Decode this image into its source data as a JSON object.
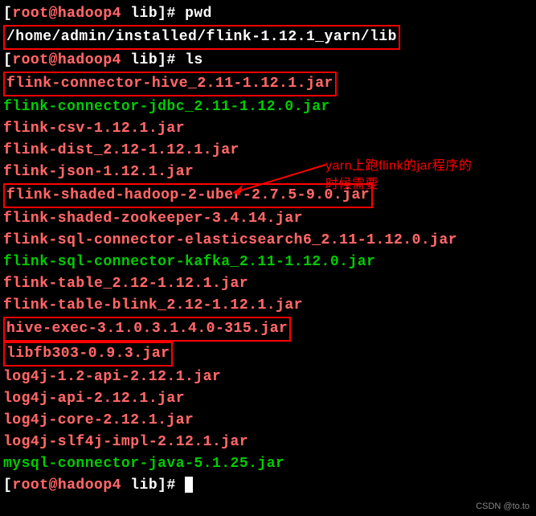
{
  "prompt1": {
    "bracket_open": "[",
    "user_host": "root@hadoop4",
    "path": " lib",
    "bracket_close": "]# ",
    "cmd": "pwd"
  },
  "pwd_output": "/home/admin/installed/flink-1.12.1_yarn/lib",
  "prompt2": {
    "bracket_open": "[",
    "user_host": "root@hadoop4",
    "path": " lib",
    "bracket_close": "]# ",
    "cmd": "ls"
  },
  "files": [
    {
      "name": "flink-connector-hive_2.11-1.12.1.jar",
      "color": "brightred",
      "boxed": true
    },
    {
      "name": "flink-connector-jdbc_2.11-1.12.0.jar",
      "color": "green",
      "boxed": false
    },
    {
      "name": "flink-csv-1.12.1.jar",
      "color": "brightred",
      "boxed": false
    },
    {
      "name": "flink-dist_2.12-1.12.1.jar",
      "color": "brightred",
      "boxed": false
    },
    {
      "name": "flink-json-1.12.1.jar",
      "color": "brightred",
      "boxed": false
    },
    {
      "name": "flink-shaded-hadoop-2-uber-2.7.5-9.0.jar",
      "color": "brightred",
      "boxed": true
    },
    {
      "name": "flink-shaded-zookeeper-3.4.14.jar",
      "color": "brightred",
      "boxed": false
    },
    {
      "name": "flink-sql-connector-elasticsearch6_2.11-1.12.0.jar",
      "color": "brightred",
      "boxed": false
    },
    {
      "name": "flink-sql-connector-kafka_2.11-1.12.0.jar",
      "color": "green",
      "boxed": false
    },
    {
      "name": "flink-table_2.12-1.12.1.jar",
      "color": "brightred",
      "boxed": false
    },
    {
      "name": "flink-table-blink_2.12-1.12.1.jar",
      "color": "brightred",
      "boxed": false
    },
    {
      "name": "hive-exec-3.1.0.3.1.4.0-315.jar",
      "color": "brightred",
      "boxed": true
    },
    {
      "name": "libfb303-0.9.3.jar",
      "color": "brightred",
      "boxed": true
    },
    {
      "name": "log4j-1.2-api-2.12.1.jar",
      "color": "brightred",
      "boxed": false
    },
    {
      "name": "log4j-api-2.12.1.jar",
      "color": "brightred",
      "boxed": false
    },
    {
      "name": "log4j-core-2.12.1.jar",
      "color": "brightred",
      "boxed": false
    },
    {
      "name": "log4j-slf4j-impl-2.12.1.jar",
      "color": "brightred",
      "boxed": false
    },
    {
      "name": "mysql-connector-java-5.1.25.jar",
      "color": "green",
      "boxed": false
    }
  ],
  "prompt3": {
    "bracket_open": "[",
    "user_host": "root@hadoop4",
    "path": " lib",
    "bracket_close": "]# "
  },
  "annotation": {
    "line1": "yarn上跑flink的jar程序的",
    "line2": "时候需要"
  },
  "watermark": "CSDN @to.to"
}
